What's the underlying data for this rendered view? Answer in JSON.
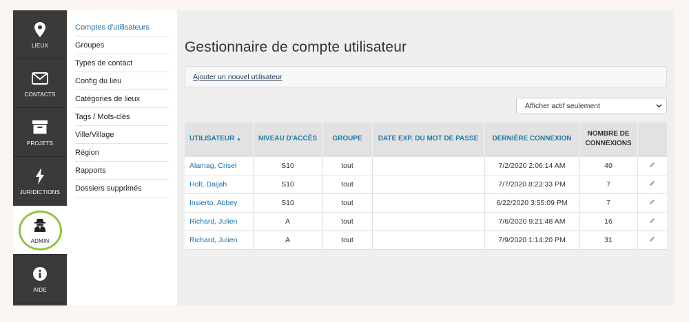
{
  "nav": {
    "items": [
      {
        "label": "LIEUX",
        "icon": "map-pin-icon"
      },
      {
        "label": "CONTACTS",
        "icon": "envelope-icon"
      },
      {
        "label": "PROJETS",
        "icon": "archive-box-icon"
      },
      {
        "label": "JURIDICTIONS",
        "icon": "lightning-bolt-icon"
      },
      {
        "label": "ADMIN",
        "icon": "spy-agent-icon",
        "active": true
      },
      {
        "label": "AIDE",
        "icon": "info-circle-icon"
      }
    ]
  },
  "subnav": {
    "items": [
      {
        "label": "Comptes d'utilisateurs",
        "active": true
      },
      {
        "label": "Groupes"
      },
      {
        "label": "Types de contact"
      },
      {
        "label": "Config du lieu"
      },
      {
        "label": "Catégories de lieux"
      },
      {
        "label": "Tags / Mots-clés"
      },
      {
        "label": "Ville/Village"
      },
      {
        "label": "Région"
      },
      {
        "label": "Rapports"
      },
      {
        "label": "Dossiers supprimés"
      }
    ]
  },
  "main": {
    "title": "Gestionnaire de compte utilisateur",
    "add_link": "Ajouter un nouvel utilisateur",
    "filter": {
      "selected": "Afficher actif seulement"
    },
    "table": {
      "headers": {
        "user": "UTILISATEUR",
        "sort_icon": "▲",
        "access": "NIVEAU D'ACCÈS",
        "group": "GROUPE",
        "expiry": "DATE EXP. DU MOT DE PASSE",
        "last_login": "DERNIÈRE CONNEXION",
        "count_line1": "NOMBRE DE",
        "count_line2": "CONNEXIONS"
      },
      "rows": [
        {
          "user": "Alamag, Crisel",
          "access": "S10",
          "group": "tout",
          "expiry": "",
          "last_login": "7/2/2020 2:06:14 AM",
          "count": "40"
        },
        {
          "user": "Holt, Daijah",
          "access": "S10",
          "group": "tout",
          "expiry": "",
          "last_login": "7/7/2020 8:23:33 PM",
          "count": "7"
        },
        {
          "user": "Insierto, Abbey",
          "access": "S10",
          "group": "tout",
          "expiry": "",
          "last_login": "6/22/2020 3:55:09 PM",
          "count": "7"
        },
        {
          "user": "Richard, Julien",
          "access": "A",
          "group": "tout",
          "expiry": "",
          "last_login": "7/6/2020 9:21:48 AM",
          "count": "16"
        },
        {
          "user": "Richard, Julien",
          "access": "A",
          "group": "tout",
          "expiry": "",
          "last_login": "7/9/2020 1:14:20 PM",
          "count": "31"
        }
      ]
    }
  }
}
